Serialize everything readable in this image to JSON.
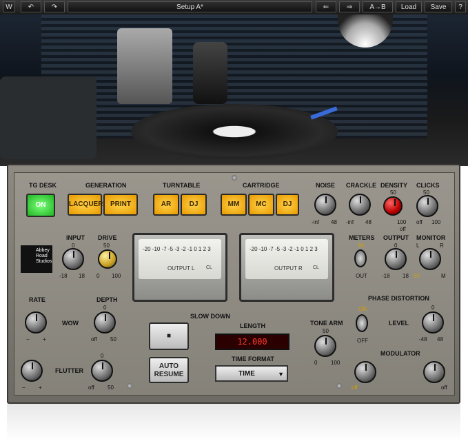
{
  "toolbar": {
    "undo_icon": "undo-icon",
    "redo_icon": "redo-icon",
    "title": "Setup A*",
    "prev_icon": "arrow-left-icon",
    "next_icon": "arrow-right-icon",
    "ab_label": "A→B",
    "load_label": "Load",
    "save_label": "Save",
    "help_label": "?"
  },
  "sections": {
    "tg_desk": "TG DESK",
    "generation": "GENERATION",
    "turntable": "TURNTABLE",
    "cartridge": "CARTRIDGE"
  },
  "buttons": {
    "on": "ON",
    "lacquer": "LACQUER",
    "print": "PRINT",
    "ar": "AR",
    "dj": "DJ",
    "mm": "MM",
    "mc": "MC",
    "dj2": "DJ"
  },
  "knobs": {
    "noise": {
      "label": "NOISE",
      "min": "-inf",
      "max": "48"
    },
    "crackle": {
      "label": "CRACKLE",
      "min": "-inf",
      "max": "48"
    },
    "density": {
      "label": "DENSITY",
      "mid": "50",
      "max": "100"
    },
    "clicks": {
      "label": "CLICKS",
      "mid": "50",
      "min": "off",
      "max": "100"
    },
    "density_off": "off",
    "input": {
      "label": "INPUT",
      "mid": "0",
      "min": "-18",
      "max": "18"
    },
    "drive": {
      "label": "DRIVE",
      "mid": "50",
      "min": "0",
      "max": "100"
    },
    "meters": {
      "label": "METERS",
      "top": "IN",
      "bottom": "OUT"
    },
    "output": {
      "label": "OUTPUT",
      "mid": "0",
      "min": "-18",
      "max": "18"
    },
    "monitor": {
      "label": "MONITOR",
      "l": "L",
      "r": "R",
      "st": "ST",
      "m": "M"
    },
    "rate": {
      "label": "RATE",
      "min": "−",
      "max": "+"
    },
    "depth": {
      "label": "DEPTH",
      "mid": "0",
      "min": "off",
      "max": "50"
    },
    "wow": "WOW",
    "flutter": "FLUTTER",
    "flutter_depth": {
      "mid": "0",
      "min": "off",
      "max": "50"
    },
    "rate2": {
      "min": "−",
      "max": "+"
    },
    "tone_arm": {
      "label": "TONE ARM",
      "mid": "50",
      "min": "0",
      "max": "100"
    },
    "phase_distortion": "PHASE DISTORTION",
    "phase_on": "ON",
    "phase_off": "OFF",
    "level": {
      "label": "LEVEL",
      "mid": "0",
      "min": "-48",
      "max": "48"
    },
    "modulator": "MODULATOR",
    "mod_left": {
      "min": "off"
    },
    "mod_right": {
      "max": "off"
    }
  },
  "meters": {
    "left": {
      "label": "OUTPUT L",
      "scale": "-20 -10 -7 -5 -3 -2 -1 0 1 2 3",
      "clip": "CL"
    },
    "right": {
      "label": "OUTPUT R",
      "scale": "-20 -10 -7 -5 -3 -2 -1 0 1 2 3",
      "clip": "CL"
    }
  },
  "slowdown": {
    "title": "SLOW DOWN",
    "length_label": "LENGTH",
    "length_value": "12.000",
    "auto_resume": "AUTO RESUME",
    "time_format_label": "TIME FORMAT",
    "time_format_value": "TIME"
  },
  "logo": {
    "text": "Abbey Road Studios"
  }
}
